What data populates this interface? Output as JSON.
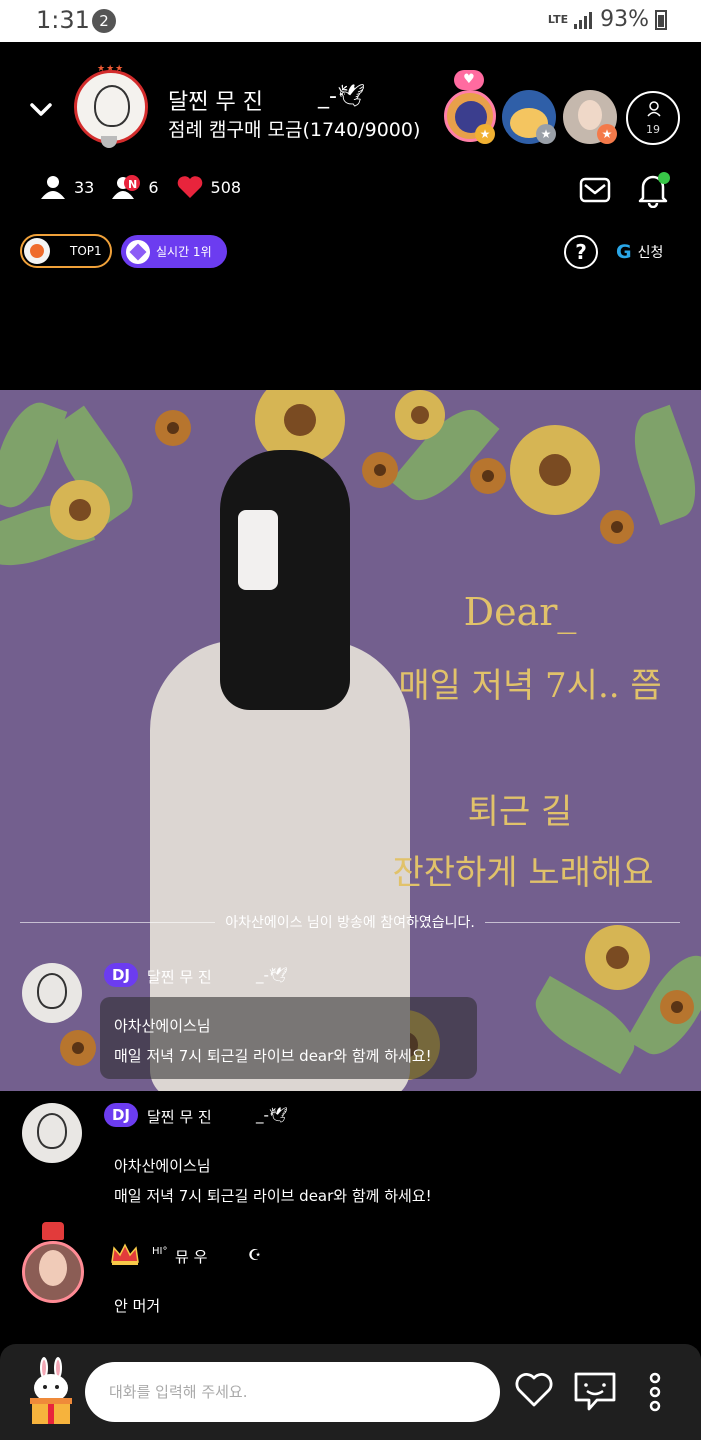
{
  "status_bar": {
    "time": "1:31",
    "notification_count": "2",
    "network": "LTE",
    "battery": "93%"
  },
  "header": {
    "dj_name": "달찐 무 진",
    "dj_name_suffix": "_-🕊",
    "subtitle": "점례 캠구매 모금(1740/9000)",
    "listener_count": "19"
  },
  "stats": {
    "listeners": "33",
    "new_listeners": "6",
    "likes": "508"
  },
  "badges": {
    "top_label": "TOP1",
    "rank_label": "실시간 1위",
    "apply_label": "신청"
  },
  "banner": {
    "line1": "Dear_",
    "line2": "매일 저녁 7시.. 쯤",
    "line3": "퇴근 길",
    "line4": "잔잔하게 노래해요"
  },
  "chat": {
    "join_notice": "아차산에이스 님이 방송에 참여하였습니다.",
    "messages": [
      {
        "badge": "DJ",
        "name": "달찐 무 진",
        "name_suffix": "_-🕊",
        "line1": "아차산에이스님",
        "line2": "매일 저녁 7시 퇴근길 라이브 dear와 함께 하세요!"
      },
      {
        "badge": "DJ",
        "name": "달찐 무 진",
        "name_suffix": "_-🕊",
        "line1": "아차산에이스님",
        "line2": "매일 저녁 7시 퇴근길 라이브 dear와 함께 하세요!"
      },
      {
        "name_prefix": "HI°",
        "name": "뮤 우",
        "name_suffix": "☪",
        "line1": "안 머거"
      }
    ]
  },
  "input": {
    "placeholder": "대화를 입력해 주세요."
  },
  "colors": {
    "accent_purple": "#6c3cf0",
    "banner_bg": "#735f8e",
    "banner_text": "#e1c26a",
    "heart_red": "#e8243c"
  },
  "icons": [
    "chevron-down-icon",
    "user-icon",
    "new-user-icon",
    "heart-icon",
    "mail-icon",
    "bell-icon",
    "help-icon",
    "g-icon",
    "rabbit-gift-icon",
    "heart-outline-icon",
    "chat-icon",
    "more-icon",
    "crown-icon"
  ]
}
